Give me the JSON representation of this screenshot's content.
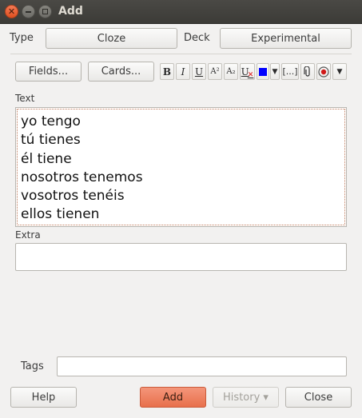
{
  "window": {
    "title": "Add"
  },
  "top_row": {
    "type_label": "Type",
    "type_value": "Cloze",
    "deck_label": "Deck",
    "deck_value": "Experimental"
  },
  "toolbar": {
    "fields_label": "Fields...",
    "cards_label": "Cards...",
    "bold_label": "B",
    "italic_label": "I",
    "underline_label": "U",
    "superscript_label": "A²",
    "subscript_label": "A₂",
    "clear_format_label": "U",
    "color_value": "#0000ff",
    "cloze_label": "[...]"
  },
  "fields": {
    "text_label": "Text",
    "text_lines": [
      "yo tengo",
      "tú tienes",
      "él tiene",
      "nosotros tenemos",
      "vosotros tenéis",
      "ellos tienen"
    ],
    "extra_label": "Extra",
    "extra_value": ""
  },
  "tags": {
    "label": "Tags",
    "value": ""
  },
  "bottom_bar": {
    "help_label": "Help",
    "add_label": "Add",
    "history_label": "History ▾",
    "close_label": "Close"
  }
}
